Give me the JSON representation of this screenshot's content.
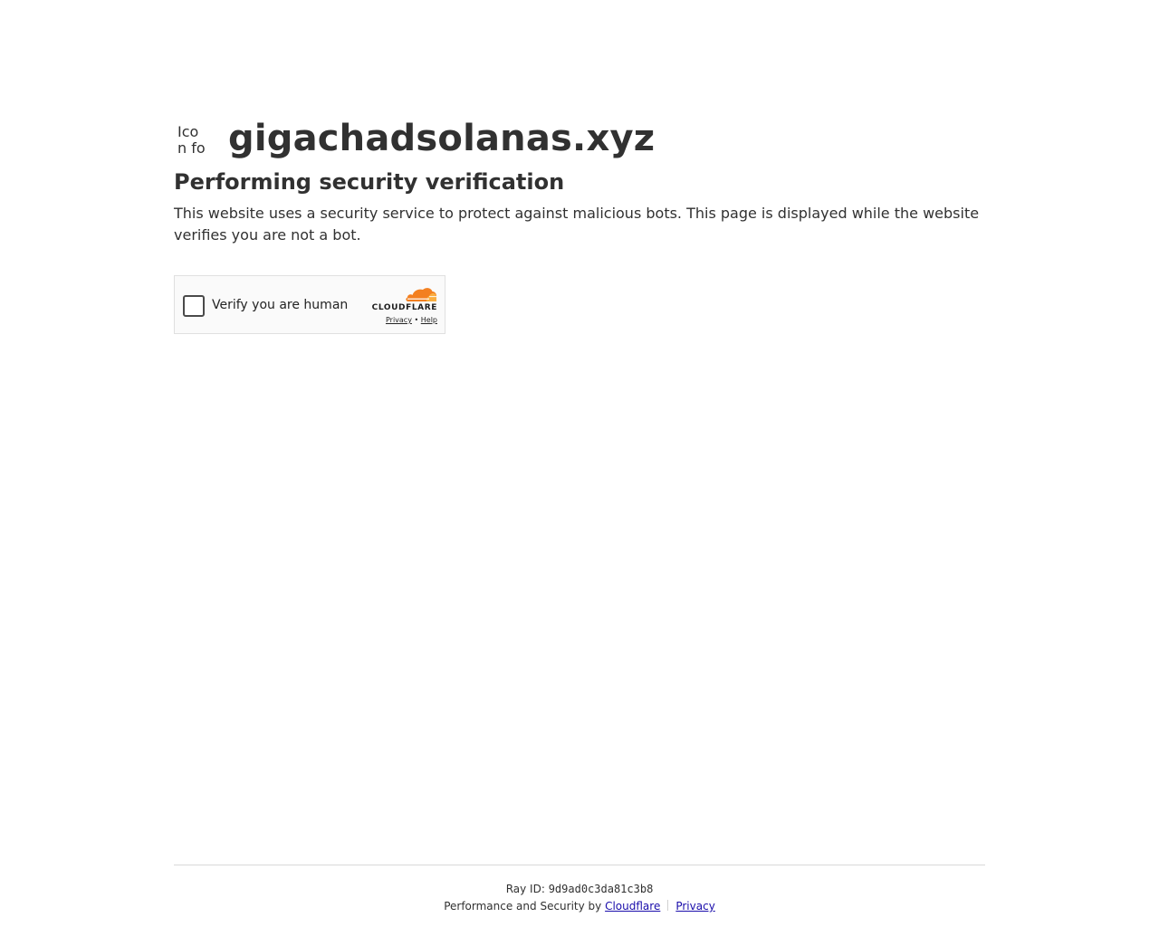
{
  "site": {
    "icon_alt": "Icon for gigachadsolanas.xyz",
    "name": "gigachadsolanas.xyz"
  },
  "main": {
    "headline": "Performing security verification",
    "description": "This website uses a security service to protect against malicious bots. This page is displayed while the website verifies you are not a bot."
  },
  "widget": {
    "checkbox_label": "Verify you are human",
    "brand": "CLOUDFLARE",
    "privacy_link": "Privacy",
    "separator": "•",
    "help_link": "Help",
    "icon": "cloudflare-cloud-icon"
  },
  "footer": {
    "ray_label": "Ray ID:",
    "ray_id": "9d9ad0c3da81c3b8",
    "perf_text": "Performance and Security by",
    "cloudflare_link": "Cloudflare",
    "privacy_link": "Privacy"
  },
  "colors": {
    "cloud_orange": "#f38020",
    "cloud_light": "#faae40",
    "text": "#313131",
    "link": "#1a0dab"
  }
}
